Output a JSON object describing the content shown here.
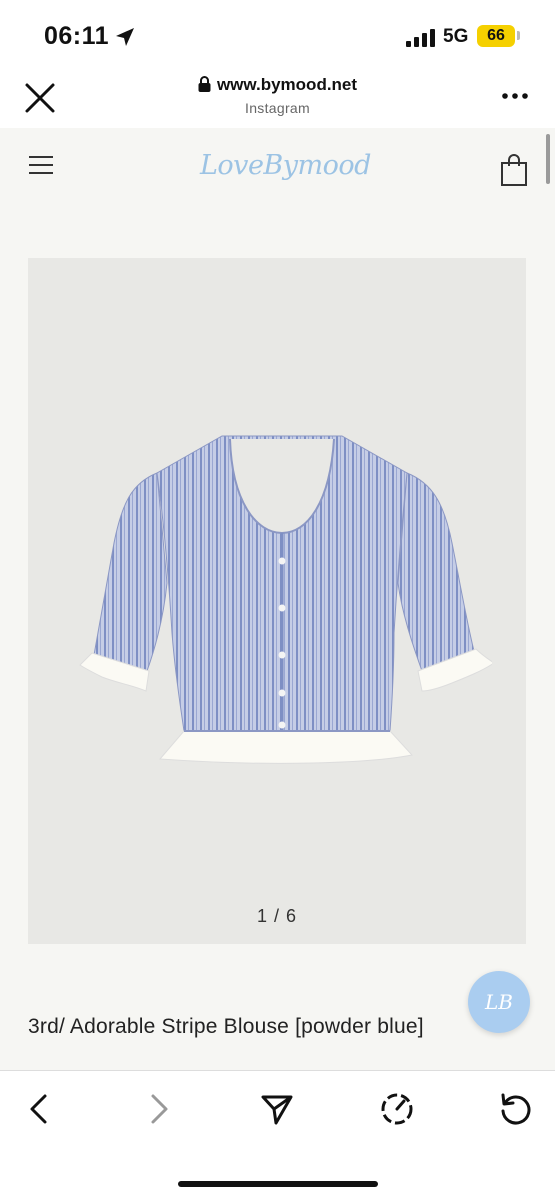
{
  "status_bar": {
    "time": "06:11",
    "network": "5G",
    "battery": "66"
  },
  "browser": {
    "url": "www.bymood.net",
    "subtitle": "Instagram"
  },
  "site": {
    "logo": "LoveBymood"
  },
  "product": {
    "pager": "1 / 6",
    "title": "3rd/ Adorable Stripe Blouse [powder blue]",
    "image_colors": {
      "stripe": "#7e8fc4",
      "base": "#c5cde6",
      "ruffle": "#fbfaf4"
    }
  },
  "float_badge": {
    "label": "LB"
  },
  "toolbar": {
    "icons": [
      "back-arrow-icon",
      "forward-arrow-icon",
      "share-icon",
      "speed-icon",
      "reload-icon"
    ]
  },
  "colors": {
    "page_bg": "#f6f6f3",
    "image_bg": "#e8e8e5",
    "logo": "#9cc3e4",
    "badge": "#aacdf0",
    "battery": "#f5d000"
  }
}
